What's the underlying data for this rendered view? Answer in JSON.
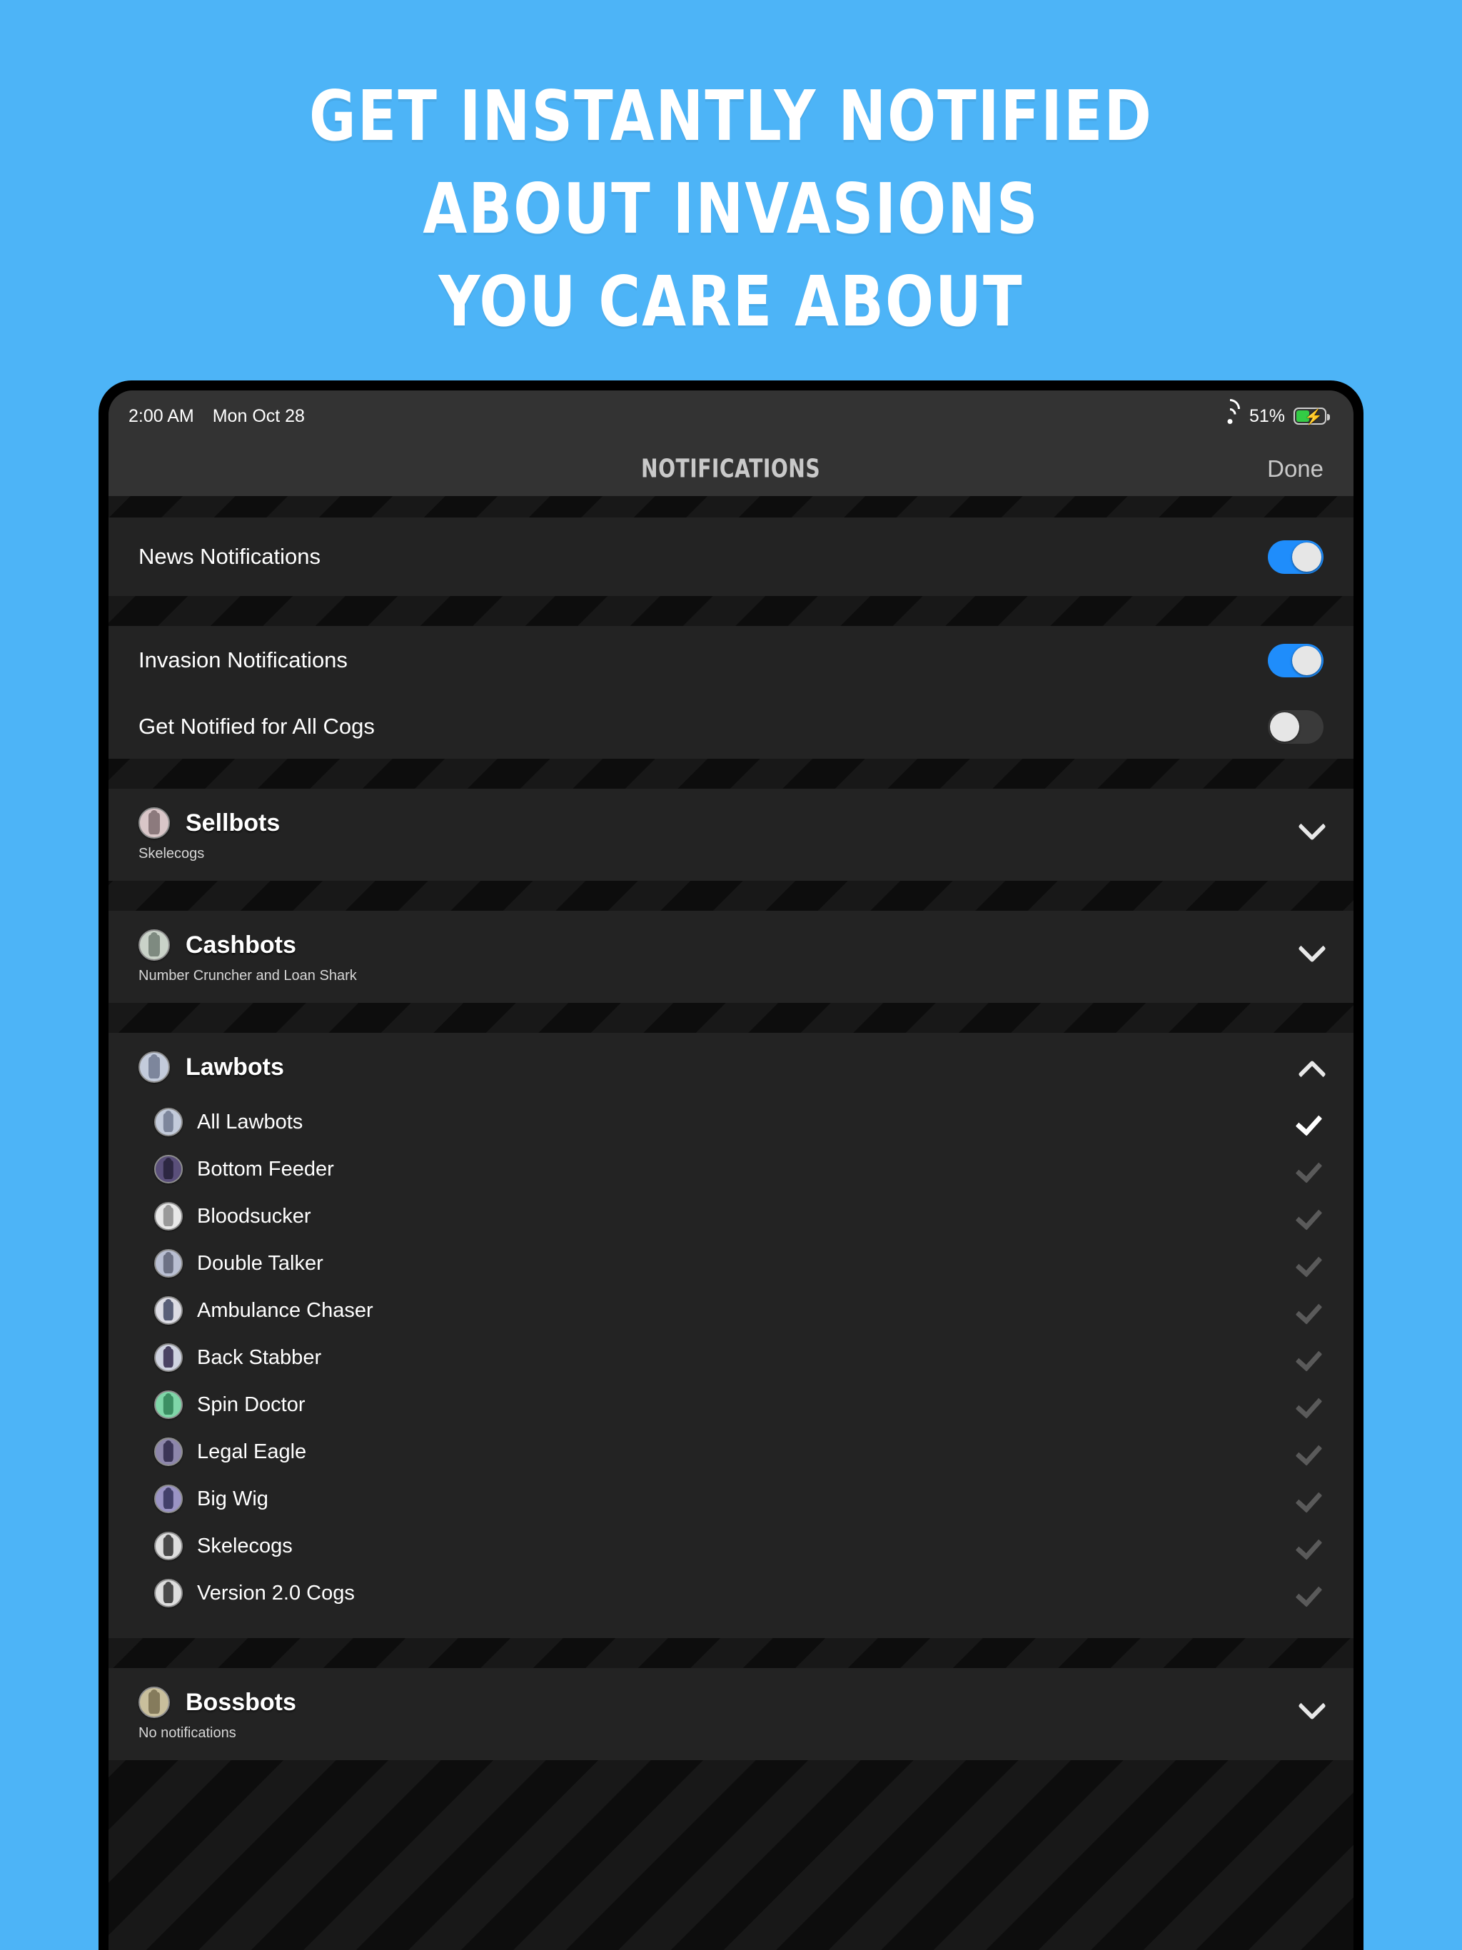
{
  "marketing": {
    "headline_lines": [
      "Get Instantly Notified",
      "About Invasions",
      "You Care About"
    ],
    "bg_color": "#4db4f7",
    "text_color": "#ffffff"
  },
  "status_bar": {
    "time": "2:00 AM",
    "date": "Mon Oct 28",
    "wifi_icon": "wifi-icon",
    "battery_percent": "51%",
    "battery_icon": "battery-charging-icon",
    "battery_color": "#33cc45"
  },
  "nav": {
    "title": "NOTIFICATIONS",
    "done_label": "Done"
  },
  "settings": {
    "news": {
      "label": "News Notifications",
      "state": "on"
    },
    "invasion": {
      "label": "Invasion Notifications",
      "state": "on"
    },
    "all_cogs": {
      "label": "Get Notified for All Cogs",
      "state": "off"
    }
  },
  "accent_color": "#1f8dfb",
  "groups": [
    {
      "name": "Sellbots",
      "subtitle": "Skelecogs",
      "expanded": false,
      "chevron": "chevron-down-icon",
      "icon_color": "#d9c6c8",
      "icon_accent": "#8c7a7d",
      "items": []
    },
    {
      "name": "Cashbots",
      "subtitle": "Number Cruncher and Loan Shark",
      "expanded": false,
      "chevron": "chevron-down-icon",
      "icon_color": "#c9d2c8",
      "icon_accent": "#7e8a80",
      "items": []
    },
    {
      "name": "Lawbots",
      "subtitle": "",
      "expanded": true,
      "chevron": "chevron-up-icon",
      "icon_color": "#c3cbdb",
      "icon_accent": "#7d869c",
      "items": [
        {
          "label": "All Lawbots",
          "checked": true,
          "icon_color": "#c3cbdb",
          "icon_accent": "#7d869c"
        },
        {
          "label": "Bottom Feeder",
          "checked": false,
          "icon_color": "#5a4f7a",
          "icon_accent": "#2d2742"
        },
        {
          "label": "Bloodsucker",
          "checked": false,
          "icon_color": "#e8e8e8",
          "icon_accent": "#9a9a9a"
        },
        {
          "label": "Double Talker",
          "checked": false,
          "icon_color": "#b9bfd2",
          "icon_accent": "#6d7285"
        },
        {
          "label": "Ambulance Chaser",
          "checked": false,
          "icon_color": "#dcdce4",
          "icon_accent": "#595f78"
        },
        {
          "label": "Back Stabber",
          "checked": false,
          "icon_color": "#cfd3e0",
          "icon_accent": "#4a4363"
        },
        {
          "label": "Spin Doctor",
          "checked": false,
          "icon_color": "#7fd6a8",
          "icon_accent": "#3c8f63"
        },
        {
          "label": "Legal Eagle",
          "checked": false,
          "icon_color": "#8d86ab",
          "icon_accent": "#3b3557"
        },
        {
          "label": "Big Wig",
          "checked": false,
          "icon_color": "#9a93c4",
          "icon_accent": "#43406b"
        },
        {
          "label": "Skelecogs",
          "checked": false,
          "icon_color": "#dedede",
          "icon_accent": "#4a4a4a"
        },
        {
          "label": "Version 2.0 Cogs",
          "checked": false,
          "icon_color": "#dedede",
          "icon_accent": "#4a4a4a"
        }
      ]
    },
    {
      "name": "Bossbots",
      "subtitle": "No notifications",
      "expanded": false,
      "chevron": "chevron-down-icon",
      "icon_color": "#c9bf9c",
      "icon_accent": "#857b5c",
      "items": []
    }
  ]
}
